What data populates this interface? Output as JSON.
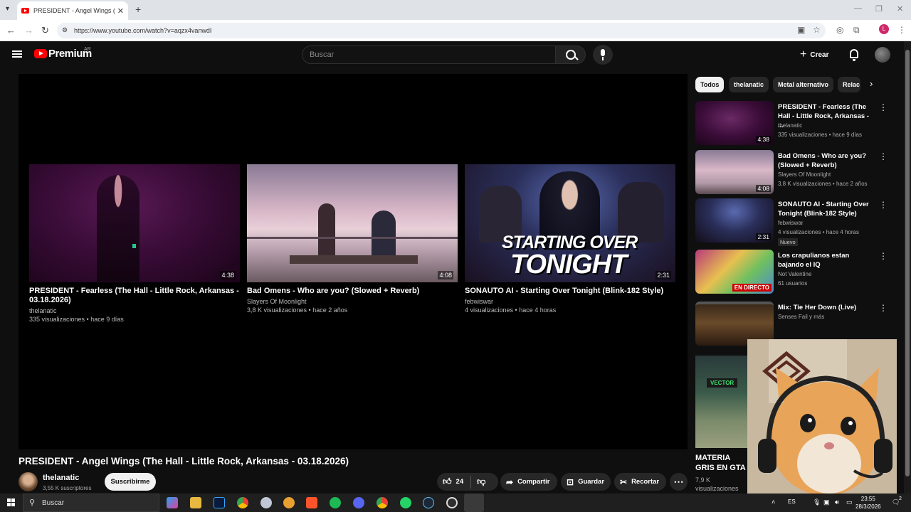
{
  "browser": {
    "tab_title": "PRESIDENT - Angel Wings (The",
    "tab_close": "✕",
    "new_tab": "+",
    "url": "https://www.youtube.com/watch?v=aqzx4vanwdI",
    "profile_letter": "L"
  },
  "header": {
    "logo": "Premium",
    "region": "AR",
    "search_placeholder": "Buscar",
    "create_label": "Crear"
  },
  "player": {
    "end_cards": [
      {
        "title": "PRESIDENT - Fearless (The Hall - Little Rock, Arkansas - 03.18.2026)",
        "channel": "thelanatic",
        "meta": "335 visualizaciones • hace 9 días",
        "duration": "4:38"
      },
      {
        "title": "Bad Omens - Who are you? (Slowed + Reverb)",
        "channel": "Slayers Of Moonlight",
        "meta": "3,8 K visualizaciones • hace 2 años",
        "duration": "4:08"
      },
      {
        "title": "SONAUTO AI - Starting Over Tonight (Blink-182 Style)",
        "channel": "febwiswar",
        "meta": "4 visualizaciones • hace 4 horas",
        "duration": "2:31",
        "thumb_text_1": "STARTING OVER",
        "thumb_text_2": "TONIGHT"
      }
    ]
  },
  "video": {
    "title": "PRESIDENT - Angel Wings (The Hall - Little Rock, Arkansas - 03.18.2026)",
    "channel": "thelanatic",
    "subscribers": "3,55 K suscriptores",
    "subscribe_label": "Suscribirme",
    "likes": "24",
    "share_label": "Compartir",
    "save_label": "Guardar",
    "clip_label": "Recortar"
  },
  "sidebar": {
    "chips": [
      "Todos",
      "thelanatic",
      "Metal alternativo",
      "Relac"
    ],
    "recommendations": [
      {
        "title": "PRESIDENT - Fearless (The Hall - Little Rock, Arkansas - ...",
        "channel": "thelanatic",
        "meta": "335 visualizaciones • hace 9 días",
        "duration": "4:38"
      },
      {
        "title": "Bad Omens - Who are you? (Slowed + Reverb)",
        "channel": "Slayers Of Moonlight",
        "meta": "3,8 K visualizaciones • hace 2 años",
        "duration": "4:08"
      },
      {
        "title": "SONAUTO AI - Starting Over Tonight (Blink-182 Style)",
        "channel": "febwiswar",
        "meta": "4 visualizaciones • hace 4 horas",
        "duration": "2:31",
        "badge": "Nuevo"
      },
      {
        "title": "Los crapulianos estan bajando el IQ",
        "channel": "Not Valentine",
        "meta": "61 usuarios",
        "live_label": "EN DIRECTO"
      },
      {
        "title": "Mix: Tie Her Down (Live)",
        "channel": "Senses Fail y más"
      }
    ],
    "partial": {
      "title": "MATERIA GRIS EN GTA",
      "views": "7,9 K visualizaciones",
      "badge": "VECTOR"
    }
  },
  "taskbar": {
    "search_label": "Buscar",
    "lang": "ES",
    "time": "23:55",
    "date": "28/3/2026",
    "notif_count": "2"
  },
  "colors": {
    "yt_red": "#ff0000",
    "background": "#0f0f0f",
    "chip_active": "#f1f1f1"
  }
}
